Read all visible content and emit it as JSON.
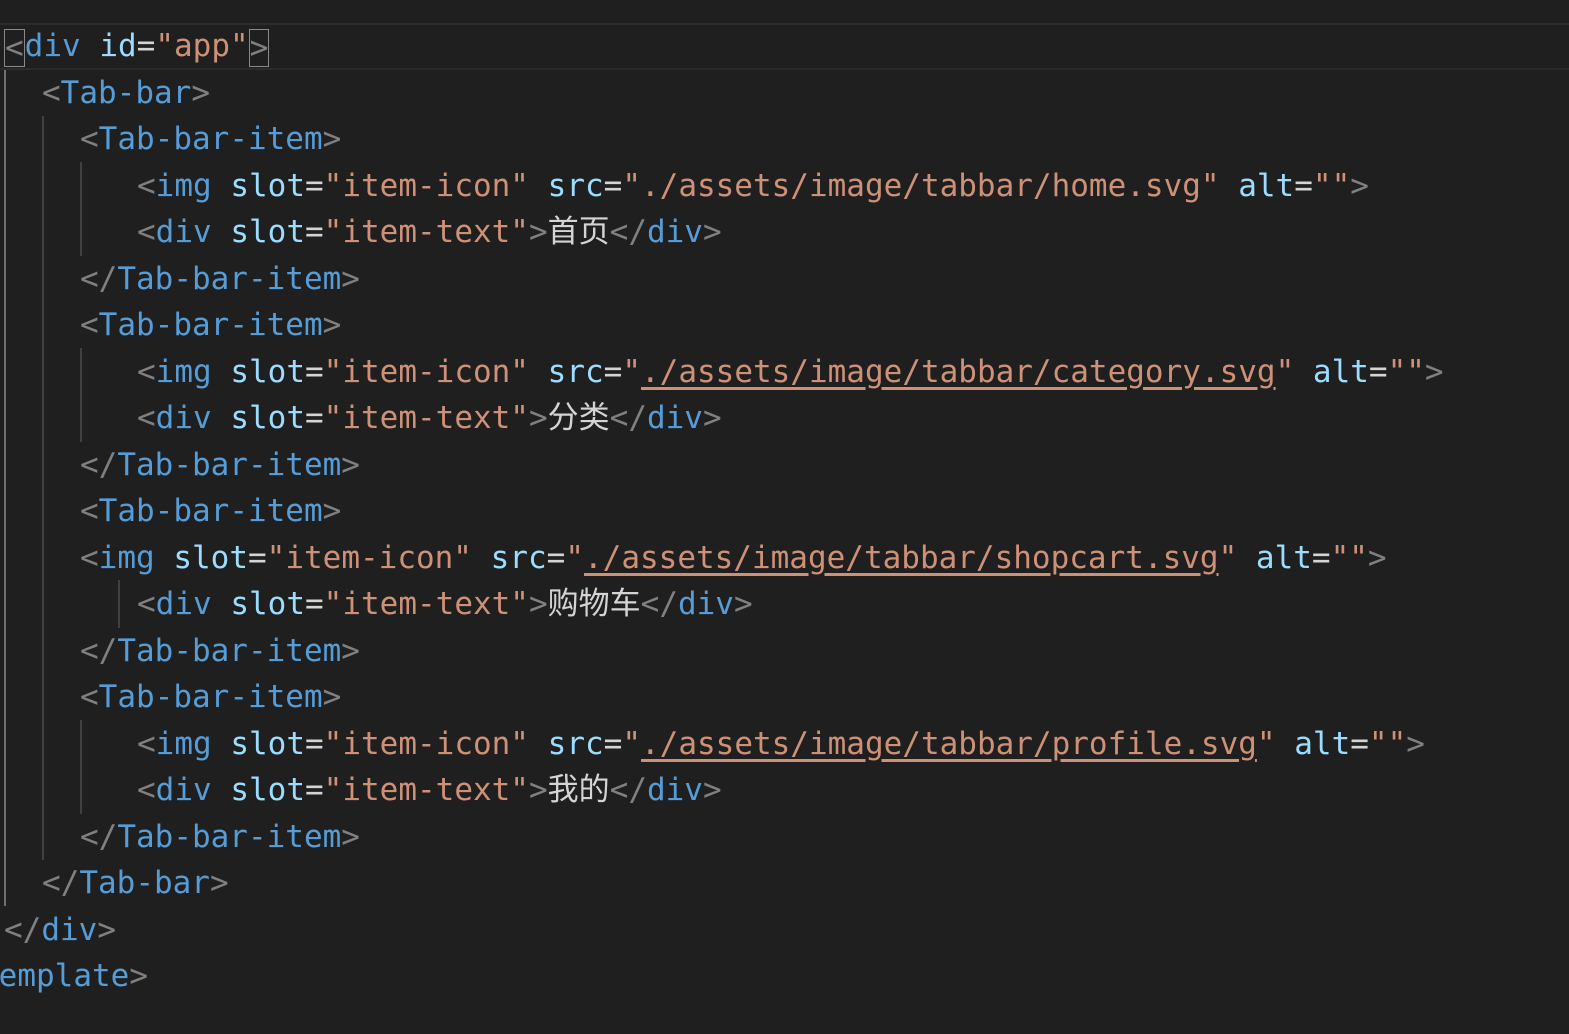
{
  "editor": {
    "colors": {
      "background": "#1f1f1f",
      "bracket": "#808080",
      "tag": "#569cd6",
      "attribute": "#9cdcfe",
      "string": "#ce9178",
      "text": "#d4d4d4"
    },
    "lines": [
      {
        "tokens": [
          {
            "t": "br",
            "v": "<",
            "boxed": true
          },
          {
            "t": "tag",
            "v": "div"
          },
          {
            "t": "txt",
            "v": " "
          },
          {
            "t": "attr",
            "v": "id"
          },
          {
            "t": "eq",
            "v": "="
          },
          {
            "t": "str",
            "v": "\"app\""
          },
          {
            "t": "br",
            "v": ">",
            "boxed": true
          }
        ]
      },
      {
        "tokens": [
          {
            "t": "br",
            "v": "<"
          },
          {
            "t": "tag",
            "v": "Tab-bar"
          },
          {
            "t": "br",
            "v": ">"
          }
        ]
      },
      {
        "tokens": [
          {
            "t": "br",
            "v": "<"
          },
          {
            "t": "tag",
            "v": "Tab-bar-item"
          },
          {
            "t": "br",
            "v": ">"
          }
        ]
      },
      {
        "tokens": [
          {
            "t": "br",
            "v": "<"
          },
          {
            "t": "tag",
            "v": "img"
          },
          {
            "t": "txt",
            "v": " "
          },
          {
            "t": "attr",
            "v": "slot"
          },
          {
            "t": "eq",
            "v": "="
          },
          {
            "t": "str",
            "v": "\"item-icon\""
          },
          {
            "t": "txt",
            "v": " "
          },
          {
            "t": "attr",
            "v": "src"
          },
          {
            "t": "eq",
            "v": "="
          },
          {
            "t": "str",
            "v": "\"./assets/image/tabbar/home.svg\""
          },
          {
            "t": "txt",
            "v": " "
          },
          {
            "t": "attr",
            "v": "alt"
          },
          {
            "t": "eq",
            "v": "="
          },
          {
            "t": "str",
            "v": "\"\""
          },
          {
            "t": "br",
            "v": ">"
          }
        ]
      },
      {
        "tokens": [
          {
            "t": "br",
            "v": "<"
          },
          {
            "t": "tag",
            "v": "div"
          },
          {
            "t": "txt",
            "v": " "
          },
          {
            "t": "attr",
            "v": "slot"
          },
          {
            "t": "eq",
            "v": "="
          },
          {
            "t": "str",
            "v": "\"item-text\""
          },
          {
            "t": "br",
            "v": ">"
          },
          {
            "t": "txt",
            "v": "首页"
          },
          {
            "t": "br",
            "v": "</"
          },
          {
            "t": "tag",
            "v": "div"
          },
          {
            "t": "br",
            "v": ">"
          }
        ]
      },
      {
        "tokens": [
          {
            "t": "br",
            "v": "</"
          },
          {
            "t": "tag",
            "v": "Tab-bar-item"
          },
          {
            "t": "br",
            "v": ">"
          }
        ]
      },
      {
        "tokens": [
          {
            "t": "br",
            "v": "<"
          },
          {
            "t": "tag",
            "v": "Tab-bar-item"
          },
          {
            "t": "br",
            "v": ">"
          }
        ]
      },
      {
        "tokens": [
          {
            "t": "br",
            "v": "<"
          },
          {
            "t": "tag",
            "v": "img"
          },
          {
            "t": "txt",
            "v": " "
          },
          {
            "t": "attr",
            "v": "slot"
          },
          {
            "t": "eq",
            "v": "="
          },
          {
            "t": "str",
            "v": "\"item-icon\""
          },
          {
            "t": "txt",
            "v": " "
          },
          {
            "t": "attr",
            "v": "src"
          },
          {
            "t": "eq",
            "v": "="
          },
          {
            "t": "str",
            "v": "\""
          },
          {
            "t": "link",
            "v": "./assets/image/tabbar/category.svg"
          },
          {
            "t": "str",
            "v": "\""
          },
          {
            "t": "txt",
            "v": " "
          },
          {
            "t": "attr",
            "v": "alt"
          },
          {
            "t": "eq",
            "v": "="
          },
          {
            "t": "str",
            "v": "\"\""
          },
          {
            "t": "br",
            "v": ">"
          }
        ]
      },
      {
        "tokens": [
          {
            "t": "br",
            "v": "<"
          },
          {
            "t": "tag",
            "v": "div"
          },
          {
            "t": "txt",
            "v": " "
          },
          {
            "t": "attr",
            "v": "slot"
          },
          {
            "t": "eq",
            "v": "="
          },
          {
            "t": "str",
            "v": "\"item-text\""
          },
          {
            "t": "br",
            "v": ">"
          },
          {
            "t": "txt",
            "v": "分类"
          },
          {
            "t": "br",
            "v": "</"
          },
          {
            "t": "tag",
            "v": "div"
          },
          {
            "t": "br",
            "v": ">"
          }
        ]
      },
      {
        "tokens": [
          {
            "t": "br",
            "v": "</"
          },
          {
            "t": "tag",
            "v": "Tab-bar-item"
          },
          {
            "t": "br",
            "v": ">"
          }
        ]
      },
      {
        "tokens": [
          {
            "t": "br",
            "v": "<"
          },
          {
            "t": "tag",
            "v": "Tab-bar-item"
          },
          {
            "t": "br",
            "v": ">"
          }
        ]
      },
      {
        "tokens": [
          {
            "t": "br",
            "v": "<"
          },
          {
            "t": "tag",
            "v": "img"
          },
          {
            "t": "txt",
            "v": " "
          },
          {
            "t": "attr",
            "v": "slot"
          },
          {
            "t": "eq",
            "v": "="
          },
          {
            "t": "str",
            "v": "\"item-icon\""
          },
          {
            "t": "txt",
            "v": " "
          },
          {
            "t": "attr",
            "v": "src"
          },
          {
            "t": "eq",
            "v": "="
          },
          {
            "t": "str",
            "v": "\""
          },
          {
            "t": "link",
            "v": "./assets/image/tabbar/shopcart.svg"
          },
          {
            "t": "str",
            "v": "\""
          },
          {
            "t": "txt",
            "v": " "
          },
          {
            "t": "attr",
            "v": "alt"
          },
          {
            "t": "eq",
            "v": "="
          },
          {
            "t": "str",
            "v": "\"\""
          },
          {
            "t": "br",
            "v": ">"
          }
        ]
      },
      {
        "tokens": [
          {
            "t": "br",
            "v": "<"
          },
          {
            "t": "tag",
            "v": "div"
          },
          {
            "t": "txt",
            "v": " "
          },
          {
            "t": "attr",
            "v": "slot"
          },
          {
            "t": "eq",
            "v": "="
          },
          {
            "t": "str",
            "v": "\"item-text\""
          },
          {
            "t": "br",
            "v": ">"
          },
          {
            "t": "txt",
            "v": "购物车"
          },
          {
            "t": "br",
            "v": "</"
          },
          {
            "t": "tag",
            "v": "div"
          },
          {
            "t": "br",
            "v": ">"
          }
        ]
      },
      {
        "tokens": [
          {
            "t": "br",
            "v": "</"
          },
          {
            "t": "tag",
            "v": "Tab-bar-item"
          },
          {
            "t": "br",
            "v": ">"
          }
        ]
      },
      {
        "tokens": [
          {
            "t": "br",
            "v": "<"
          },
          {
            "t": "tag",
            "v": "Tab-bar-item"
          },
          {
            "t": "br",
            "v": ">"
          }
        ]
      },
      {
        "tokens": [
          {
            "t": "br",
            "v": "<"
          },
          {
            "t": "tag",
            "v": "img"
          },
          {
            "t": "txt",
            "v": " "
          },
          {
            "t": "attr",
            "v": "slot"
          },
          {
            "t": "eq",
            "v": "="
          },
          {
            "t": "str",
            "v": "\"item-icon\""
          },
          {
            "t": "txt",
            "v": " "
          },
          {
            "t": "attr",
            "v": "src"
          },
          {
            "t": "eq",
            "v": "="
          },
          {
            "t": "str",
            "v": "\""
          },
          {
            "t": "link",
            "v": "./assets/image/tabbar/profile.svg"
          },
          {
            "t": "str",
            "v": "\""
          },
          {
            "t": "txt",
            "v": " "
          },
          {
            "t": "attr",
            "v": "alt"
          },
          {
            "t": "eq",
            "v": "="
          },
          {
            "t": "str",
            "v": "\"\""
          },
          {
            "t": "br",
            "v": ">"
          }
        ]
      },
      {
        "tokens": [
          {
            "t": "br",
            "v": "<"
          },
          {
            "t": "tag",
            "v": "div"
          },
          {
            "t": "txt",
            "v": " "
          },
          {
            "t": "attr",
            "v": "slot"
          },
          {
            "t": "eq",
            "v": "="
          },
          {
            "t": "str",
            "v": "\"item-text\""
          },
          {
            "t": "br",
            "v": ">"
          },
          {
            "t": "txt",
            "v": "我的"
          },
          {
            "t": "br",
            "v": "</"
          },
          {
            "t": "tag",
            "v": "div"
          },
          {
            "t": "br",
            "v": ">"
          }
        ]
      },
      {
        "tokens": [
          {
            "t": "br",
            "v": "</"
          },
          {
            "t": "tag",
            "v": "Tab-bar-item"
          },
          {
            "t": "br",
            "v": ">"
          }
        ]
      },
      {
        "tokens": [
          {
            "t": "br",
            "v": "</"
          },
          {
            "t": "tag",
            "v": "Tab-bar"
          },
          {
            "t": "br",
            "v": ">"
          }
        ]
      },
      {
        "tokens": [
          {
            "t": "br",
            "v": "</"
          },
          {
            "t": "tag",
            "v": "div"
          },
          {
            "t": "br",
            "v": ">"
          }
        ]
      },
      {
        "tokens": [
          {
            "t": "tag",
            "v": "template"
          },
          {
            "t": "br",
            "v": ">"
          }
        ]
      }
    ]
  }
}
